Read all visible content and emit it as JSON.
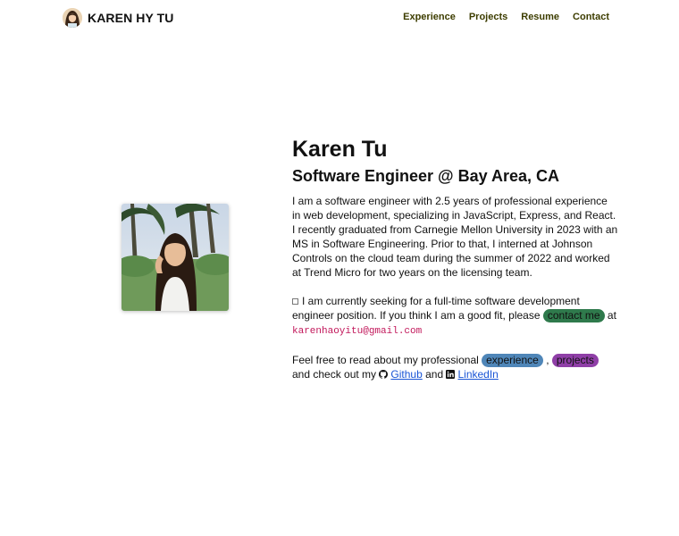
{
  "header": {
    "brand_name": "KAREN HY TU",
    "nav": {
      "experience": "Experience",
      "projects": "Projects",
      "resume": "Resume",
      "contact": "Contact"
    }
  },
  "intro": {
    "name": "Karen Tu",
    "subtitle": "Software Engineer @ Bay Area, CA",
    "bio": "I am a software engineer with 2.5 years of professional experience in web development, specializing in JavaScript, Express, and React. I recently graduated from Carnegie Mellon University in 2023 with an MS in Software Engineering. Prior to that, I interned at Johnson Controls on the cloud team during the summer of 2022 and worked at Trend Micro for two years on the licensing team.",
    "seeking_text": "I am currently seeking for a full-time software development engineer position. If you think I am a good fit, please",
    "contact_pill": "contact me",
    "at_text": "at",
    "email": "karenhaoyitu@gmail.com",
    "read_prefix": "Feel free to read about my professional",
    "experience_pill": "experience",
    "comma": ",",
    "projects_pill": "projects",
    "check_text": "and check out my",
    "github_link": "Github",
    "and_text": "and",
    "linkedin_link": "LinkedIn"
  },
  "colors": {
    "nav_text": "#3d3d00",
    "contact_pill": "#2f7a4c",
    "experience_pill": "#4f86b8",
    "projects_pill": "#8f3fa7",
    "email": "#c2185b",
    "link": "#1a55d6"
  },
  "icons": {
    "seeking": "checkbox-icon",
    "github": "github-icon",
    "linkedin": "linkedin-icon"
  }
}
